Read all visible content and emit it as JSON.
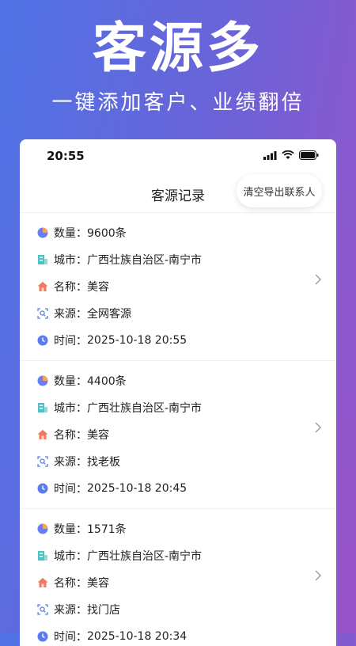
{
  "promo": {
    "title": "客源多",
    "subtitle": "一键添加客户、业绩翻倍"
  },
  "status_bar": {
    "time": "20:55"
  },
  "nav": {
    "title": "客源记录",
    "export_label": "清空导出联系人"
  },
  "labels": {
    "quantity": "数量：",
    "city": "城市：",
    "name": "名称：",
    "source": "来源：",
    "time": "时间："
  },
  "records": [
    {
      "quantity": "9600条",
      "city": "广西壮族自治区-南宁市",
      "name": "美容",
      "source": "全网客源",
      "time": "2025-10-18 20:55"
    },
    {
      "quantity": "4400条",
      "city": "广西壮族自治区-南宁市",
      "name": "美容",
      "source": "找老板",
      "time": "2025-10-18 20:45"
    },
    {
      "quantity": "1571条",
      "city": "广西壮族自治区-南宁市",
      "name": "美容",
      "source": "找门店",
      "time": "2025-10-18 20:34"
    }
  ],
  "icons": {
    "quantity": "pie-chart-icon",
    "city": "building-icon",
    "name": "home-icon",
    "source": "scan-search-icon",
    "time": "clock-icon",
    "chevron": "chevron-right-icon"
  },
  "colors": {
    "gradient_start": "#4f73e6",
    "gradient_end": "#9a52c8",
    "pie": "#6c7ef5",
    "building": "#4cc3c7",
    "home": "#f07a5c",
    "scan": "#5b7cf0",
    "clock": "#5b7cf0"
  }
}
